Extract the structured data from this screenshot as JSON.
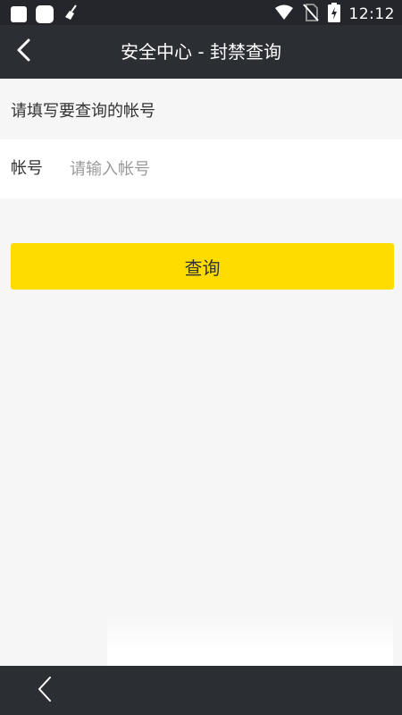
{
  "status_bar": {
    "time": "12:12",
    "icons": [
      "notification-square-icon",
      "app-square-icon",
      "broom-icon",
      "wifi-icon",
      "no-sim-icon",
      "battery-charging-icon"
    ]
  },
  "header": {
    "title": "安全中心 - 封禁查询",
    "back_icon": "chevron-left-icon"
  },
  "form": {
    "hint": "请填写要查询的帐号",
    "account_label": "帐号",
    "account_value": "",
    "account_placeholder": "请输入帐号",
    "submit_label": "查询"
  },
  "nav": {
    "back_icon": "nav-back-icon"
  },
  "colors": {
    "header_bg": "#2b2e33",
    "status_bg": "#24262b",
    "page_bg": "#f6f6f6",
    "accent": "#ffdc00"
  }
}
